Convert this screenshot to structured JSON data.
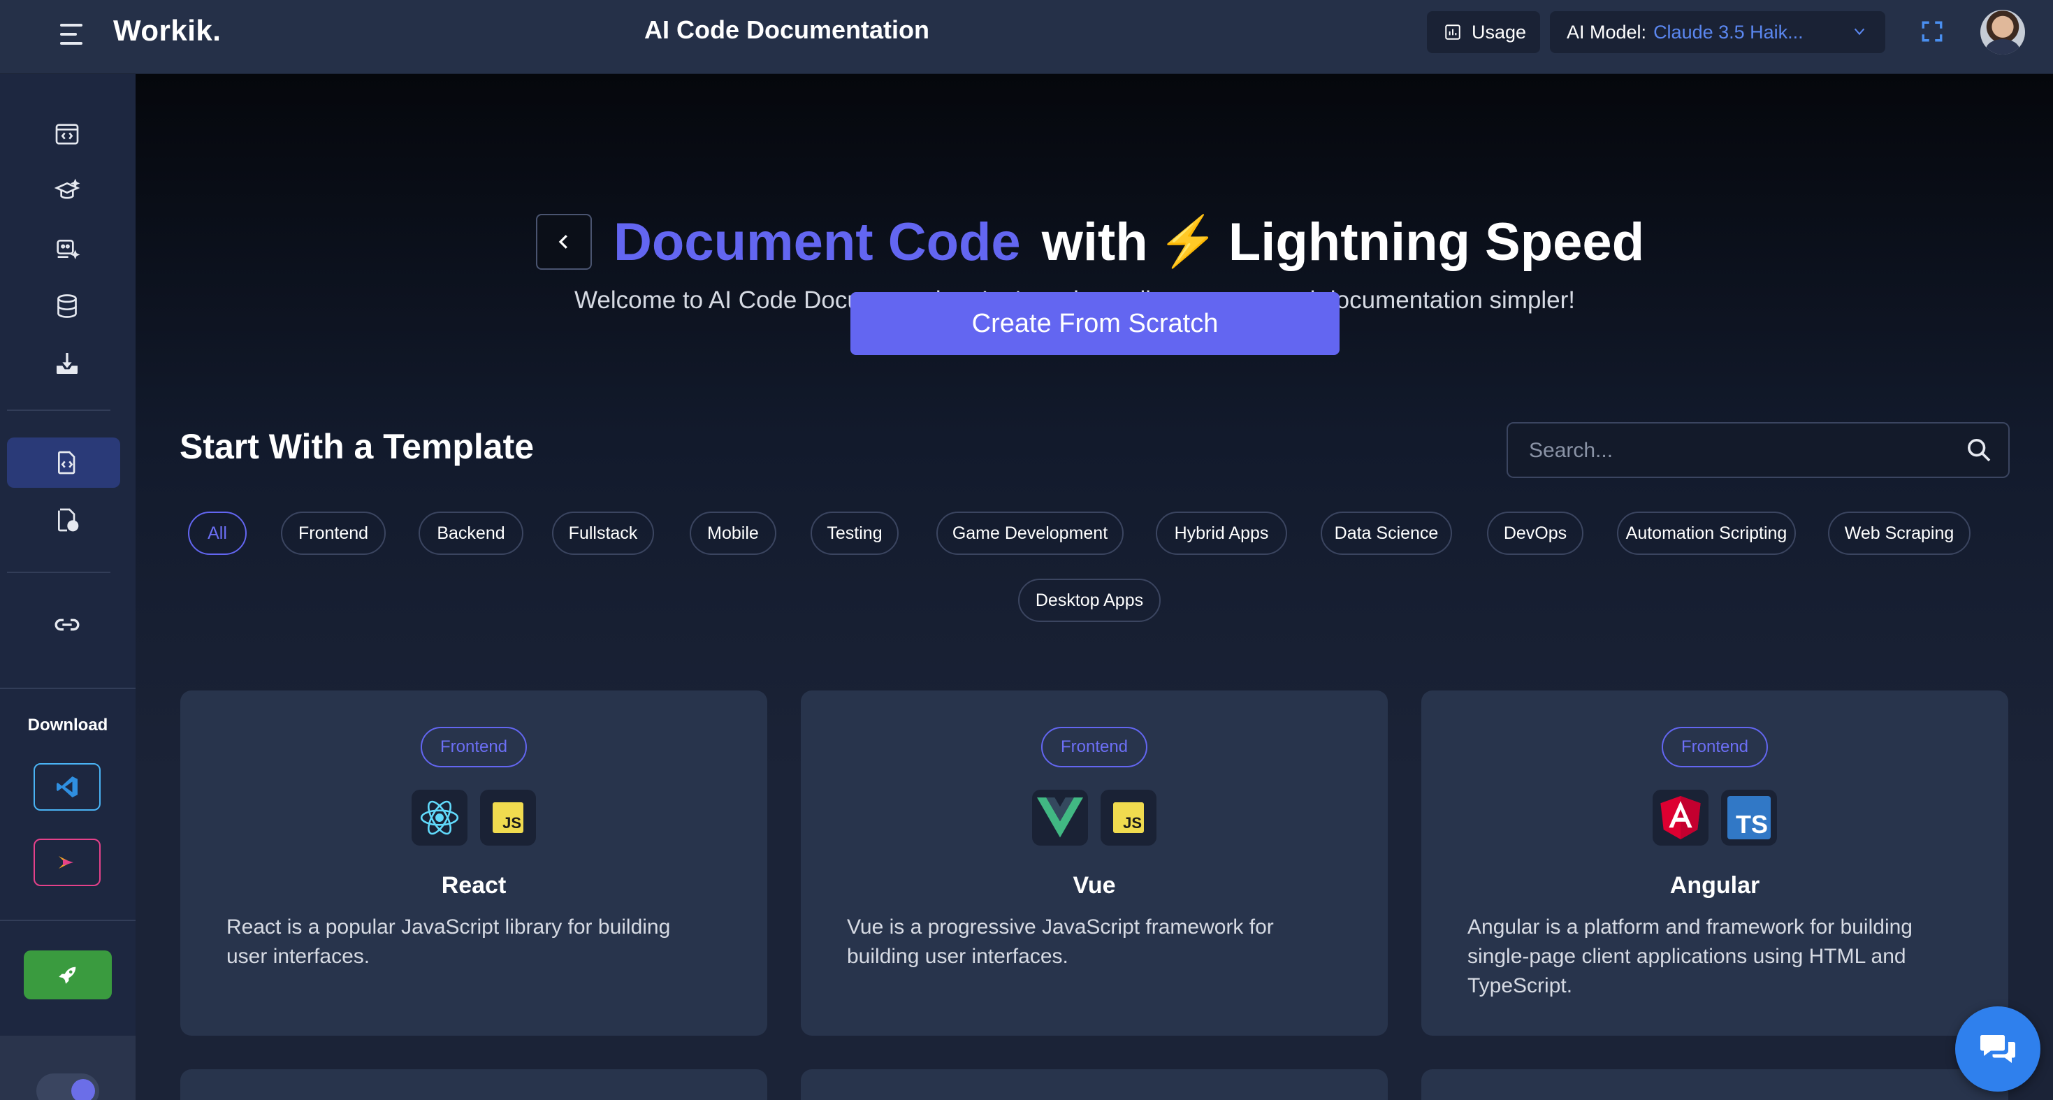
{
  "header": {
    "brand": "Workik.",
    "title": "AI Code Documentation",
    "usage_label": "Usage",
    "model_label": "AI Model:",
    "model_value": "Claude 3.5 Haik..."
  },
  "sidebar": {
    "download_label": "Download"
  },
  "hero": {
    "title_accent": "Document Code",
    "title_with": "with",
    "title_bolt": "⚡",
    "title_rest": "Lightning Speed",
    "subtitle": "Welcome to AI Code Documentation. Let's make coding smarter and documentation simpler!",
    "create_button": "Create From Scratch"
  },
  "templates": {
    "section_title": "Start With a Template",
    "search_placeholder": "Search...",
    "filters": [
      "All",
      "Frontend",
      "Backend",
      "Fullstack",
      "Mobile",
      "Testing",
      "Game Development",
      "Hybrid Apps",
      "Data Science",
      "DevOps",
      "Automation Scripting",
      "Web Scraping",
      "Desktop Apps"
    ],
    "active_filter": "All",
    "cards": [
      {
        "badge": "Frontend",
        "icons": [
          "react-icon",
          "javascript-icon"
        ],
        "name": "React",
        "description": "React is a popular JavaScript library for building user interfaces."
      },
      {
        "badge": "Frontend",
        "icons": [
          "vue-icon",
          "javascript-icon"
        ],
        "name": "Vue",
        "description": "Vue is a progressive JavaScript framework for building user interfaces."
      },
      {
        "badge": "Frontend",
        "icons": [
          "angular-icon",
          "typescript-icon"
        ],
        "name": "Angular",
        "description": "Angular is a platform and framework for building single-page client applications using HTML and TypeScript."
      }
    ],
    "js_text": "JS",
    "ts_text": "TS"
  },
  "colors": {
    "accent": "#6366f1",
    "topbar": "#253048",
    "card": "#28344c",
    "launch": "#3a9b3f",
    "chat": "#2f80ed"
  }
}
